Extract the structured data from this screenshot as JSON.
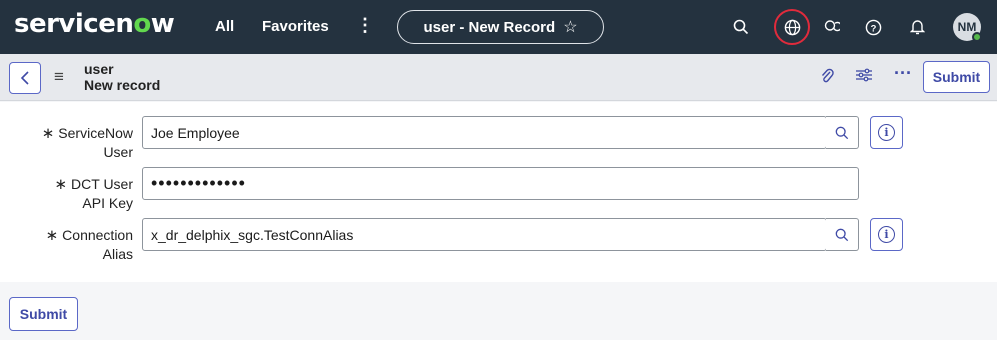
{
  "topnav": {
    "logo": "servicenow",
    "all_label": "All",
    "favorites_label": "Favorites",
    "more_label": "⋮",
    "context_title": "user - New Record",
    "avatar_initials": "NM"
  },
  "form_header": {
    "table_name": "user",
    "record_subtitle": "New record",
    "submit_label": "Submit"
  },
  "form": {
    "fields": [
      {
        "label_line1": "ServiceNow",
        "label_line2": "User",
        "value": "Joe Employee"
      },
      {
        "label_line1": "DCT User",
        "label_line2": "API Key",
        "value": "•••••••••••••"
      },
      {
        "label_line1": "Connection",
        "label_line2": "Alias",
        "value": "x_dr_delphix_sgc.TestConnAlias"
      }
    ],
    "required_marker": "∗"
  },
  "footer": {
    "submit_label": "Submit"
  },
  "colors": {
    "nav_bg": "#24323f",
    "accent": "#3f4aa6",
    "logo_green": "#62d84e",
    "highlight_ring": "#e02b3c"
  },
  "icons": [
    "search-icon",
    "globe-icon",
    "chat-icon",
    "help-icon",
    "bell-icon",
    "star-icon",
    "back-icon",
    "menu-icon",
    "paperclip-icon",
    "settings-sliders-icon",
    "more-icon",
    "info-icon"
  ]
}
